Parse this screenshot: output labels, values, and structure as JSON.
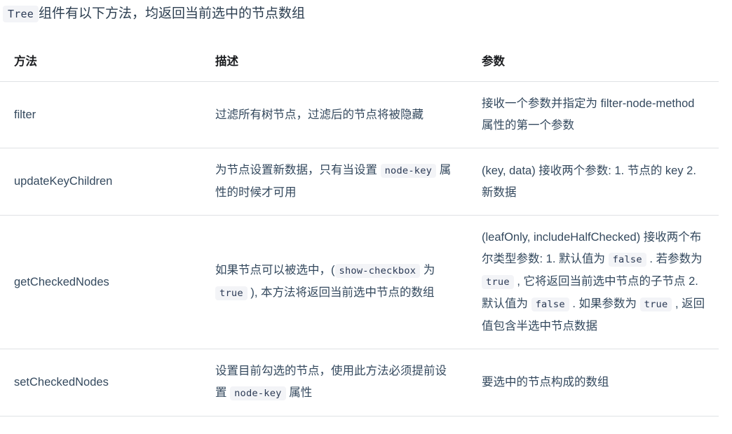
{
  "intro": {
    "code": "Tree",
    "text": "组件有以下方法，均返回当前选中的节点数组"
  },
  "table": {
    "headers": {
      "method": "方法",
      "description": "描述",
      "params": "参数"
    },
    "rows": [
      {
        "method": "filter",
        "description_parts": [
          {
            "type": "text",
            "value": "过滤所有树节点，过滤后的节点将被隐藏"
          }
        ],
        "params_parts": [
          {
            "type": "text",
            "value": "接收一个参数并指定为 filter-node-method 属性的第一个参数"
          }
        ]
      },
      {
        "method": "updateKeyChildren",
        "description_parts": [
          {
            "type": "text",
            "value": "为节点设置新数据，只有当设置 "
          },
          {
            "type": "code",
            "value": "node-key"
          },
          {
            "type": "text",
            "value": " 属性的时候才可用"
          }
        ],
        "params_parts": [
          {
            "type": "text",
            "value": "(key, data) 接收两个参数: 1. 节点的 key 2. 新数据"
          }
        ]
      },
      {
        "method": "getCheckedNodes",
        "description_parts": [
          {
            "type": "text",
            "value": "如果节点可以被选中，("
          },
          {
            "type": "code",
            "value": "show-checkbox"
          },
          {
            "type": "text",
            "value": " 为 "
          },
          {
            "type": "code",
            "value": "true"
          },
          {
            "type": "text",
            "value": " ), 本方法将返回当前选中节点的数组"
          }
        ],
        "params_parts": [
          {
            "type": "text",
            "value": "(leafOnly, includeHalfChecked) 接收两个布尔类型参数: 1. 默认值为 "
          },
          {
            "type": "code",
            "value": "false"
          },
          {
            "type": "text",
            "value": " . 若参数为 "
          },
          {
            "type": "code",
            "value": "true"
          },
          {
            "type": "text",
            "value": " , 它将返回当前选中节点的子节点 2. 默认值为 "
          },
          {
            "type": "code",
            "value": "false"
          },
          {
            "type": "text",
            "value": " . 如果参数为 "
          },
          {
            "type": "code",
            "value": "true"
          },
          {
            "type": "text",
            "value": " , 返回值包含半选中节点数据"
          }
        ]
      },
      {
        "method": "setCheckedNodes",
        "description_parts": [
          {
            "type": "text",
            "value": "设置目前勾选的节点，使用此方法必须提前设置 "
          },
          {
            "type": "code",
            "value": "node-key"
          },
          {
            "type": "text",
            "value": " 属性"
          }
        ],
        "params_parts": [
          {
            "type": "text",
            "value": "要选中的节点构成的数组"
          }
        ]
      }
    ]
  },
  "colors": {
    "text": "#34495e",
    "heading": "#1c1e21",
    "code_bg": "#f3f4f7",
    "code_text": "#2b3a55",
    "divider": "#dfe2e5"
  }
}
